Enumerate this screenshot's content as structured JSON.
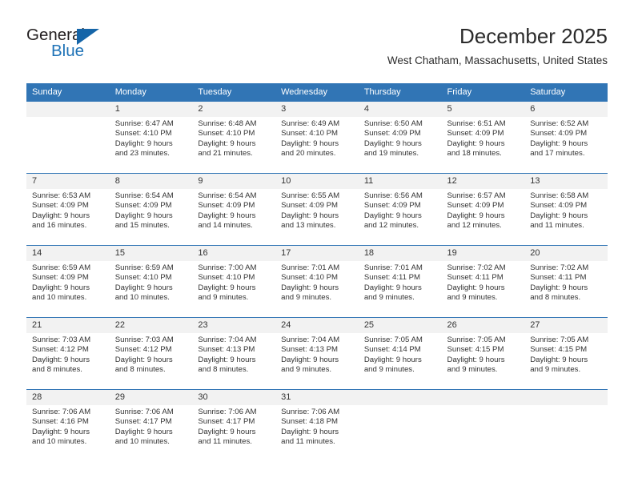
{
  "brand": {
    "name_part1": "General",
    "name_part2": "Blue",
    "accent_color": "#1f73b7",
    "triangle_color": "#1565a8"
  },
  "header": {
    "month_title": "December 2025",
    "location": "West Chatham, Massachusetts, United States"
  },
  "calendar": {
    "header_bg": "#3175b5",
    "daynum_bg": "#f2f2f2",
    "weekdays": [
      "Sunday",
      "Monday",
      "Tuesday",
      "Wednesday",
      "Thursday",
      "Friday",
      "Saturday"
    ],
    "weeks": [
      [
        {
          "day": "",
          "empty": true,
          "sunrise": "",
          "sunset": "",
          "daylight1": "",
          "daylight2": ""
        },
        {
          "day": "1",
          "sunrise": "Sunrise: 6:47 AM",
          "sunset": "Sunset: 4:10 PM",
          "daylight1": "Daylight: 9 hours",
          "daylight2": "and 23 minutes."
        },
        {
          "day": "2",
          "sunrise": "Sunrise: 6:48 AM",
          "sunset": "Sunset: 4:10 PM",
          "daylight1": "Daylight: 9 hours",
          "daylight2": "and 21 minutes."
        },
        {
          "day": "3",
          "sunrise": "Sunrise: 6:49 AM",
          "sunset": "Sunset: 4:10 PM",
          "daylight1": "Daylight: 9 hours",
          "daylight2": "and 20 minutes."
        },
        {
          "day": "4",
          "sunrise": "Sunrise: 6:50 AM",
          "sunset": "Sunset: 4:09 PM",
          "daylight1": "Daylight: 9 hours",
          "daylight2": "and 19 minutes."
        },
        {
          "day": "5",
          "sunrise": "Sunrise: 6:51 AM",
          "sunset": "Sunset: 4:09 PM",
          "daylight1": "Daylight: 9 hours",
          "daylight2": "and 18 minutes."
        },
        {
          "day": "6",
          "sunrise": "Sunrise: 6:52 AM",
          "sunset": "Sunset: 4:09 PM",
          "daylight1": "Daylight: 9 hours",
          "daylight2": "and 17 minutes."
        }
      ],
      [
        {
          "day": "7",
          "sunrise": "Sunrise: 6:53 AM",
          "sunset": "Sunset: 4:09 PM",
          "daylight1": "Daylight: 9 hours",
          "daylight2": "and 16 minutes."
        },
        {
          "day": "8",
          "sunrise": "Sunrise: 6:54 AM",
          "sunset": "Sunset: 4:09 PM",
          "daylight1": "Daylight: 9 hours",
          "daylight2": "and 15 minutes."
        },
        {
          "day": "9",
          "sunrise": "Sunrise: 6:54 AM",
          "sunset": "Sunset: 4:09 PM",
          "daylight1": "Daylight: 9 hours",
          "daylight2": "and 14 minutes."
        },
        {
          "day": "10",
          "sunrise": "Sunrise: 6:55 AM",
          "sunset": "Sunset: 4:09 PM",
          "daylight1": "Daylight: 9 hours",
          "daylight2": "and 13 minutes."
        },
        {
          "day": "11",
          "sunrise": "Sunrise: 6:56 AM",
          "sunset": "Sunset: 4:09 PM",
          "daylight1": "Daylight: 9 hours",
          "daylight2": "and 12 minutes."
        },
        {
          "day": "12",
          "sunrise": "Sunrise: 6:57 AM",
          "sunset": "Sunset: 4:09 PM",
          "daylight1": "Daylight: 9 hours",
          "daylight2": "and 12 minutes."
        },
        {
          "day": "13",
          "sunrise": "Sunrise: 6:58 AM",
          "sunset": "Sunset: 4:09 PM",
          "daylight1": "Daylight: 9 hours",
          "daylight2": "and 11 minutes."
        }
      ],
      [
        {
          "day": "14",
          "sunrise": "Sunrise: 6:59 AM",
          "sunset": "Sunset: 4:09 PM",
          "daylight1": "Daylight: 9 hours",
          "daylight2": "and 10 minutes."
        },
        {
          "day": "15",
          "sunrise": "Sunrise: 6:59 AM",
          "sunset": "Sunset: 4:10 PM",
          "daylight1": "Daylight: 9 hours",
          "daylight2": "and 10 minutes."
        },
        {
          "day": "16",
          "sunrise": "Sunrise: 7:00 AM",
          "sunset": "Sunset: 4:10 PM",
          "daylight1": "Daylight: 9 hours",
          "daylight2": "and 9 minutes."
        },
        {
          "day": "17",
          "sunrise": "Sunrise: 7:01 AM",
          "sunset": "Sunset: 4:10 PM",
          "daylight1": "Daylight: 9 hours",
          "daylight2": "and 9 minutes."
        },
        {
          "day": "18",
          "sunrise": "Sunrise: 7:01 AM",
          "sunset": "Sunset: 4:11 PM",
          "daylight1": "Daylight: 9 hours",
          "daylight2": "and 9 minutes."
        },
        {
          "day": "19",
          "sunrise": "Sunrise: 7:02 AM",
          "sunset": "Sunset: 4:11 PM",
          "daylight1": "Daylight: 9 hours",
          "daylight2": "and 9 minutes."
        },
        {
          "day": "20",
          "sunrise": "Sunrise: 7:02 AM",
          "sunset": "Sunset: 4:11 PM",
          "daylight1": "Daylight: 9 hours",
          "daylight2": "and 8 minutes."
        }
      ],
      [
        {
          "day": "21",
          "sunrise": "Sunrise: 7:03 AM",
          "sunset": "Sunset: 4:12 PM",
          "daylight1": "Daylight: 9 hours",
          "daylight2": "and 8 minutes."
        },
        {
          "day": "22",
          "sunrise": "Sunrise: 7:03 AM",
          "sunset": "Sunset: 4:12 PM",
          "daylight1": "Daylight: 9 hours",
          "daylight2": "and 8 minutes."
        },
        {
          "day": "23",
          "sunrise": "Sunrise: 7:04 AM",
          "sunset": "Sunset: 4:13 PM",
          "daylight1": "Daylight: 9 hours",
          "daylight2": "and 8 minutes."
        },
        {
          "day": "24",
          "sunrise": "Sunrise: 7:04 AM",
          "sunset": "Sunset: 4:13 PM",
          "daylight1": "Daylight: 9 hours",
          "daylight2": "and 9 minutes."
        },
        {
          "day": "25",
          "sunrise": "Sunrise: 7:05 AM",
          "sunset": "Sunset: 4:14 PM",
          "daylight1": "Daylight: 9 hours",
          "daylight2": "and 9 minutes."
        },
        {
          "day": "26",
          "sunrise": "Sunrise: 7:05 AM",
          "sunset": "Sunset: 4:15 PM",
          "daylight1": "Daylight: 9 hours",
          "daylight2": "and 9 minutes."
        },
        {
          "day": "27",
          "sunrise": "Sunrise: 7:05 AM",
          "sunset": "Sunset: 4:15 PM",
          "daylight1": "Daylight: 9 hours",
          "daylight2": "and 9 minutes."
        }
      ],
      [
        {
          "day": "28",
          "sunrise": "Sunrise: 7:06 AM",
          "sunset": "Sunset: 4:16 PM",
          "daylight1": "Daylight: 9 hours",
          "daylight2": "and 10 minutes."
        },
        {
          "day": "29",
          "sunrise": "Sunrise: 7:06 AM",
          "sunset": "Sunset: 4:17 PM",
          "daylight1": "Daylight: 9 hours",
          "daylight2": "and 10 minutes."
        },
        {
          "day": "30",
          "sunrise": "Sunrise: 7:06 AM",
          "sunset": "Sunset: 4:17 PM",
          "daylight1": "Daylight: 9 hours",
          "daylight2": "and 11 minutes."
        },
        {
          "day": "31",
          "sunrise": "Sunrise: 7:06 AM",
          "sunset": "Sunset: 4:18 PM",
          "daylight1": "Daylight: 9 hours",
          "daylight2": "and 11 minutes."
        },
        {
          "day": "",
          "empty": true,
          "sunrise": "",
          "sunset": "",
          "daylight1": "",
          "daylight2": ""
        },
        {
          "day": "",
          "empty": true,
          "sunrise": "",
          "sunset": "",
          "daylight1": "",
          "daylight2": ""
        },
        {
          "day": "",
          "empty": true,
          "sunrise": "",
          "sunset": "",
          "daylight1": "",
          "daylight2": ""
        }
      ]
    ]
  }
}
